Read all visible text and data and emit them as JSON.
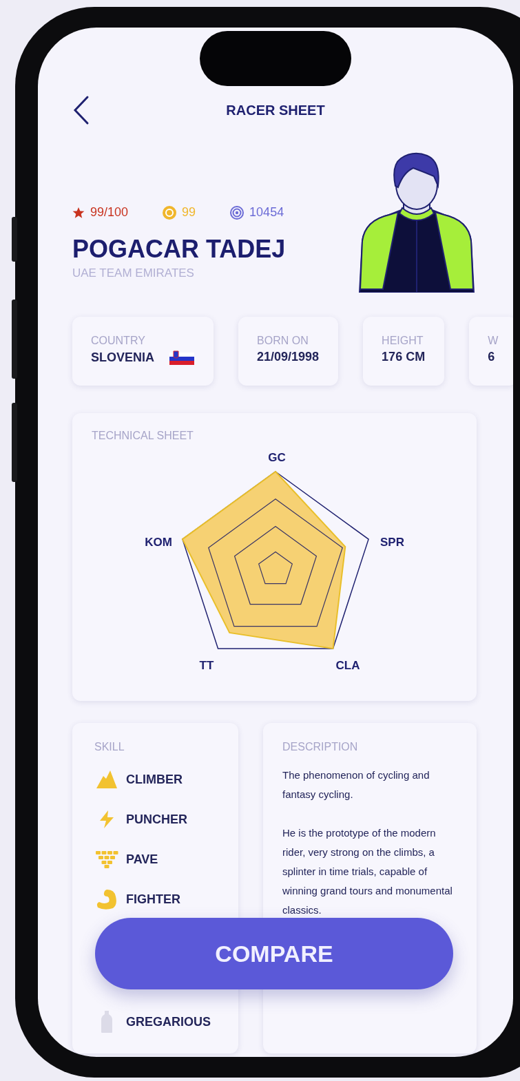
{
  "header": {
    "title": "RACER SHEET"
  },
  "stats": [
    {
      "kind": "rating",
      "text": "99/100"
    },
    {
      "kind": "coins",
      "text": "99"
    },
    {
      "kind": "points",
      "text": "10454"
    }
  ],
  "rider": {
    "name": "POGACAR TADEJ",
    "team": "UAE TEAM EMIRATES"
  },
  "info_cards": [
    {
      "kind": "country",
      "label": "COUNTRY",
      "value": "SLOVENIA"
    },
    {
      "kind": "plain",
      "label": "BORN ON",
      "value": "21/09/1998"
    },
    {
      "kind": "plain",
      "label": "HEIGHT",
      "value": "176 CM"
    },
    {
      "kind": "plain",
      "label": "W",
      "value": "6"
    }
  ],
  "technical_sheet": {
    "title": "TECHNICAL SHEET",
    "axes": [
      "GC",
      "SPR",
      "CLA",
      "TT",
      "KOM"
    ]
  },
  "skills": {
    "title": "SKILL",
    "items": [
      {
        "kind": "mountain",
        "label": "CLIMBER",
        "active": true
      },
      {
        "kind": "bolt",
        "label": "PUNCHER",
        "active": true
      },
      {
        "kind": "cobbles",
        "label": "PAVE",
        "active": true
      },
      {
        "kind": "arm",
        "label": "FIGHTER",
        "active": true
      },
      {
        "kind": "bottle",
        "label": "GREGARIOUS",
        "active": false
      }
    ]
  },
  "description": {
    "title": "DESCRIPTION",
    "paragraphs": [
      "The phenomenon of cycling and fantasy cycling.",
      "He is the prototype of the modern rider, very strong on the climbs, a splinter in time trials, capable of winning grand tours and monumental classics."
    ]
  },
  "compare_button": "COMPARE"
}
